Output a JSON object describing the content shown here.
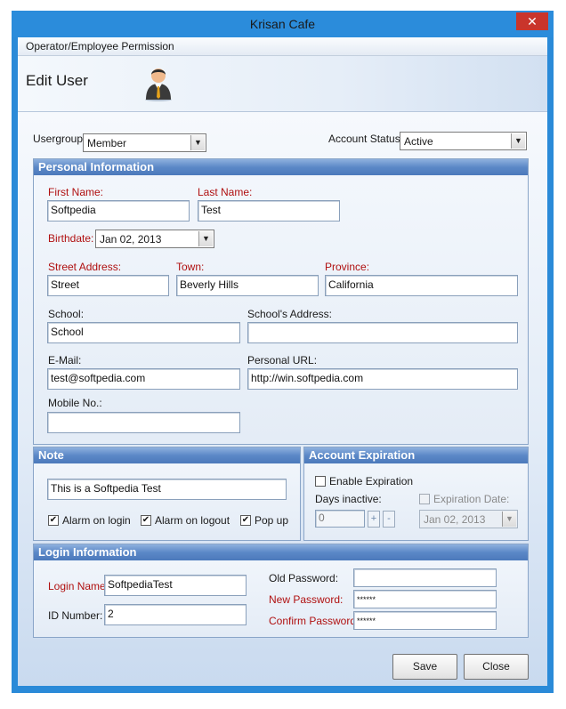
{
  "window": {
    "title": "Krisan Cafe",
    "close_glyph": "✕"
  },
  "menu": {
    "item": "Operator/Employee Permission"
  },
  "header": {
    "title": "Edit User",
    "avatar_icon": "user-avatar-icon"
  },
  "top": {
    "usergroup_label": "Usergroup:",
    "usergroup_value": "Member",
    "account_status_label": "Account Status:",
    "account_status_value": "Active"
  },
  "personal": {
    "title": "Personal Information",
    "first_name_label": "First Name:",
    "first_name": "Softpedia",
    "last_name_label": "Last Name:",
    "last_name": "Test",
    "birthdate_label": "Birthdate:",
    "birthdate": "Jan  02, 2013",
    "street_label": "Street Address:",
    "street": "Street",
    "town_label": "Town:",
    "town": "Beverly Hills",
    "province_label": "Province:",
    "province": "California",
    "school_label": "School:",
    "school": "School",
    "school_address_label": "School's Address:",
    "school_address": "",
    "email_label": "E-Mail:",
    "email": "test@softpedia.com",
    "url_label": "Personal URL:",
    "url": "http://win.softpedia.com",
    "mobile_label": "Mobile No.:",
    "mobile": ""
  },
  "note": {
    "title": "Note",
    "text": "This is a Softpedia Test",
    "alarm_login_label": "Alarm on login",
    "alarm_login": true,
    "alarm_logout_label": "Alarm on logout",
    "alarm_logout": true,
    "popup_label": "Pop up",
    "popup": true
  },
  "expiration": {
    "title": "Account Expiration",
    "enable_label": "Enable Expiration",
    "enable": false,
    "days_label": "Days inactive:",
    "days": "0",
    "plus": "+",
    "minus": "-",
    "exp_date_label": "Expiration Date:",
    "exp_date": "Jan  02, 2013"
  },
  "login": {
    "title": "Login Information",
    "login_name_label": "Login Name:",
    "login_name": "SoftpediaTest",
    "id_label": "ID Number:",
    "id": "2",
    "old_password_label": "Old Password:",
    "old_password": "",
    "new_password_label": "New Password:",
    "new_password": "******",
    "confirm_password_label": "Confirm Password:",
    "confirm_password": "******"
  },
  "buttons": {
    "save": "Save",
    "close": "Close"
  },
  "check_glyph": "✔",
  "combo_arrow": "▼",
  "colors": {
    "titlebar": "#2b8cdb",
    "close": "#c9352b",
    "group_header": "#5b88c7",
    "required_label": "#b01010"
  }
}
